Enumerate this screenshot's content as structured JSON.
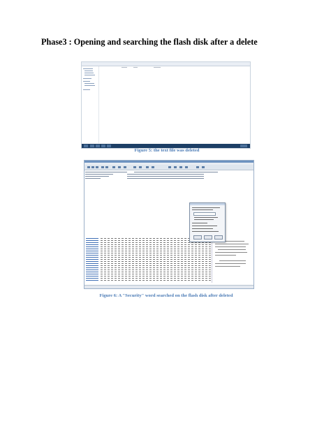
{
  "heading": "Phase3 : Opening and searching the flash disk after a delete",
  "figure5": {
    "caption": "Figure 5: the text file was deleted"
  },
  "figure6": {
    "caption": "Figure 6: A \"Security\" word searched on the flash disk after deleted"
  },
  "colors": {
    "caption": "#4a7ab5",
    "taskbar": "#1d3f66",
    "hex_offset": "#3f6fb5"
  }
}
